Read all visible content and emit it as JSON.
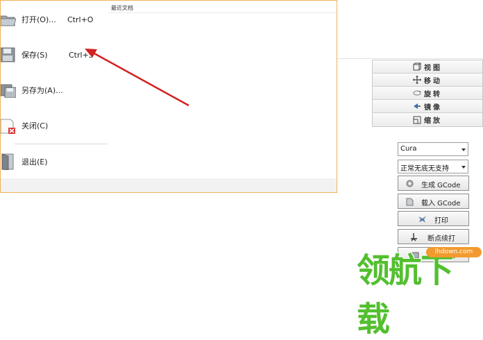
{
  "file_menu": {
    "items": [
      {
        "label": "打开(O)...",
        "accel": "Ctrl+O",
        "icon": "folder-open-icon"
      },
      {
        "label": "保存(S)",
        "accel": "Ctrl+S",
        "icon": "floppy-disk-icon"
      },
      {
        "label": "另存为(A)...",
        "accel": "",
        "icon": "save-as-icon"
      },
      {
        "label": "关闭(C)",
        "accel": "",
        "icon": "close-document-icon"
      },
      {
        "label": "退出(E)",
        "accel": "",
        "icon": "exit-door-icon"
      }
    ],
    "recent_title": "最近文档",
    "border_color": "#f0b15a"
  },
  "view_tools": [
    {
      "label": "视图",
      "icon": "cube-view-icon"
    },
    {
      "label": "移动",
      "icon": "move-arrows-icon"
    },
    {
      "label": "旋转",
      "icon": "rotate-icon"
    },
    {
      "label": "镜像",
      "icon": "mirror-icon"
    },
    {
      "label": "缩放",
      "icon": "scale-icon"
    }
  ],
  "slicer_select": {
    "value": "Cura"
  },
  "support_select": {
    "value": "正常无底无支持"
  },
  "actions": [
    {
      "label": "生成 GCode",
      "icon": "gear-icon"
    },
    {
      "label": "载入 GCode",
      "icon": "load-icon"
    },
    {
      "label": "打印",
      "icon": "print-icon"
    },
    {
      "label": "断点续打",
      "icon": "resume-print-icon"
    },
    {
      "label": "模拟打印",
      "icon": "simulate-print-icon"
    }
  ],
  "watermark": {
    "domain": "lhdown.com",
    "text": "领航下载"
  },
  "colors": {
    "annotation_arrow": "#d42020",
    "watermark_green": "#53bf2f",
    "watermark_orange": "#f29a2e"
  }
}
